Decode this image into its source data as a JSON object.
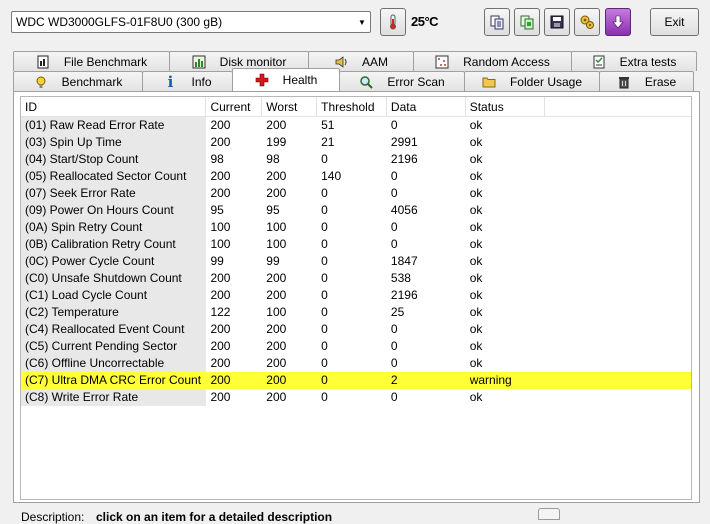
{
  "toolbar": {
    "drive": "WDC WD3000GLFS-01F8U0 (300 gB)",
    "temperature": "25°C",
    "exit_label": "Exit",
    "icons": [
      "copy-text-icon",
      "copy-to-clipboard-icon",
      "save-icon",
      "options-icon",
      "download-icon"
    ]
  },
  "tabs": {
    "row1": [
      {
        "label": "File Benchmark",
        "icon": "file-benchmark-icon"
      },
      {
        "label": "Disk monitor",
        "icon": "disk-monitor-icon"
      },
      {
        "label": "AAM",
        "icon": "speaker-icon"
      },
      {
        "label": "Random Access",
        "icon": "random-access-icon"
      },
      {
        "label": "Extra tests",
        "icon": "extra-tests-icon"
      }
    ],
    "row2": [
      {
        "label": "Benchmark",
        "icon": "lightbulb-icon"
      },
      {
        "label": "Info",
        "icon": "info-icon"
      },
      {
        "label": "Health",
        "icon": "health-cross-icon",
        "active": true
      },
      {
        "label": "Error Scan",
        "icon": "magnifier-icon"
      },
      {
        "label": "Folder Usage",
        "icon": "folder-icon"
      },
      {
        "label": "Erase",
        "icon": "trash-icon"
      }
    ]
  },
  "table": {
    "columns": [
      "ID",
      "Current",
      "Worst",
      "Threshold",
      "Data",
      "Status"
    ],
    "rows": [
      [
        "(01) Raw Read Error Rate",
        "200",
        "200",
        "51",
        "0",
        "ok"
      ],
      [
        "(03) Spin Up Time",
        "200",
        "199",
        "21",
        "2991",
        "ok"
      ],
      [
        "(04) Start/Stop Count",
        "98",
        "98",
        "0",
        "2196",
        "ok"
      ],
      [
        "(05) Reallocated Sector Count",
        "200",
        "200",
        "140",
        "0",
        "ok"
      ],
      [
        "(07) Seek Error Rate",
        "200",
        "200",
        "0",
        "0",
        "ok"
      ],
      [
        "(09) Power On Hours Count",
        "95",
        "95",
        "0",
        "4056",
        "ok"
      ],
      [
        "(0A) Spin Retry Count",
        "100",
        "100",
        "0",
        "0",
        "ok"
      ],
      [
        "(0B) Calibration Retry Count",
        "100",
        "100",
        "0",
        "0",
        "ok"
      ],
      [
        "(0C) Power Cycle Count",
        "99",
        "99",
        "0",
        "1847",
        "ok"
      ],
      [
        "(C0) Unsafe Shutdown Count",
        "200",
        "200",
        "0",
        "538",
        "ok"
      ],
      [
        "(C1) Load Cycle Count",
        "200",
        "200",
        "0",
        "2196",
        "ok"
      ],
      [
        "(C2) Temperature",
        "122",
        "100",
        "0",
        "25",
        "ok"
      ],
      [
        "(C4) Reallocated Event Count",
        "200",
        "200",
        "0",
        "0",
        "ok"
      ],
      [
        "(C5) Current Pending Sector",
        "200",
        "200",
        "0",
        "0",
        "ok"
      ],
      [
        "(C6) Offline Uncorrectable",
        "200",
        "200",
        "0",
        "0",
        "ok"
      ],
      [
        "(C7) Ultra DMA CRC Error Count",
        "200",
        "200",
        "0",
        "2",
        "warning"
      ],
      [
        "(C8) Write Error Rate",
        "200",
        "200",
        "0",
        "0",
        "ok"
      ]
    ],
    "highlight_color": "#ffff37"
  },
  "footer": {
    "description_label": "Description:",
    "description_text": "click on an item for a detailed description"
  }
}
